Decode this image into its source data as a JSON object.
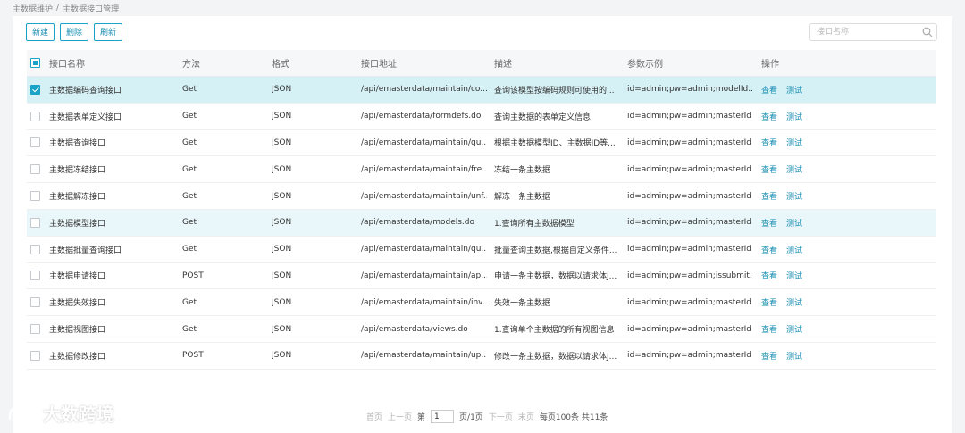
{
  "breadcrumb": {
    "first": "主数据维护",
    "separator": "/",
    "current": "主数据接口管理"
  },
  "toolbar": {
    "new_label": "新建",
    "delete_label": "删除",
    "refresh_label": "刷新"
  },
  "search": {
    "placeholder": "接口名称",
    "value": ""
  },
  "table": {
    "headers": {
      "name": "接口名称",
      "method": "方法",
      "format": "格式",
      "url": "接口地址",
      "desc": "描述",
      "params": "参数示例",
      "ops": "操作"
    },
    "view_label": "查看",
    "test_label": "测试",
    "rows": [
      {
        "name": "主数据编码查询接口",
        "method": "Get",
        "format": "JSON",
        "url": "/api/emasterdata/maintain/co...",
        "desc": "查询该模型按编码规则可使用的...",
        "params": "id=admin;pw=admin;modelId..."
      },
      {
        "name": "主数据表单定义接口",
        "method": "Get",
        "format": "JSON",
        "url": "/api/emasterdata/formdefs.do",
        "desc": "查询主数据的表单定义信息",
        "params": "id=admin;pw=admin;masterId..."
      },
      {
        "name": "主数据查询接口",
        "method": "Get",
        "format": "JSON",
        "url": "/api/emasterdata/maintain/qu...",
        "desc": "根据主数据模型ID、主数据ID等...",
        "params": "id=admin;pw=admin;masterId..."
      },
      {
        "name": "主数据冻结接口",
        "method": "Get",
        "format": "JSON",
        "url": "/api/emasterdata/maintain/fre...",
        "desc": "冻结一条主数据",
        "params": "id=admin;pw=admin;masterId..."
      },
      {
        "name": "主数据解冻接口",
        "method": "Get",
        "format": "JSON",
        "url": "/api/emasterdata/maintain/unf...",
        "desc": "解冻一条主数据",
        "params": "id=admin;pw=admin;masterId..."
      },
      {
        "name": "主数据模型接口",
        "method": "Get",
        "format": "JSON",
        "url": "/api/emasterdata/models.do",
        "desc": "1.查询所有主数据模型",
        "params": "id=admin;pw=admin;masterId..."
      },
      {
        "name": "主数据批量查询接口",
        "method": "Get",
        "format": "JSON",
        "url": "/api/emasterdata/maintain/qu...",
        "desc": "批量查询主数据,根据自定义条件...",
        "params": "id=admin;pw=admin;masterId..."
      },
      {
        "name": "主数据申请接口",
        "method": "POST",
        "format": "JSON",
        "url": "/api/emasterdata/maintain/ap...",
        "desc": "申请一条主数据，数据以请求体J...",
        "params": "id=admin;pw=admin;issubmit..."
      },
      {
        "name": "主数据失效接口",
        "method": "Get",
        "format": "JSON",
        "url": "/api/emasterdata/maintain/inv...",
        "desc": "失效一条主数据",
        "params": "id=admin;pw=admin;masterId..."
      },
      {
        "name": "主数据视图接口",
        "method": "Get",
        "format": "JSON",
        "url": "/api/emasterdata/views.do",
        "desc": "1.查询单个主数据的所有视图信息",
        "params": "id=admin;pw=admin;masterId..."
      },
      {
        "name": "主数据修改接口",
        "method": "POST",
        "format": "JSON",
        "url": "/api/emasterdata/maintain/up...",
        "desc": "修改一条主数据，数据以请求体J...",
        "params": "id=admin;pw=admin;masterId..."
      }
    ]
  },
  "pager": {
    "first": "首页",
    "prev": "上一页",
    "page_prefix": "第",
    "page_value": "1",
    "page_suffix": "页/1页",
    "next": "下一页",
    "last": "末页",
    "info": "每页100条 共11条"
  },
  "watermark": {
    "text": "大数跨境"
  },
  "colors": {
    "accent": "#1aa3c7",
    "selected_row": "#d6f1f6",
    "hover_row": "#eaf7fa"
  }
}
